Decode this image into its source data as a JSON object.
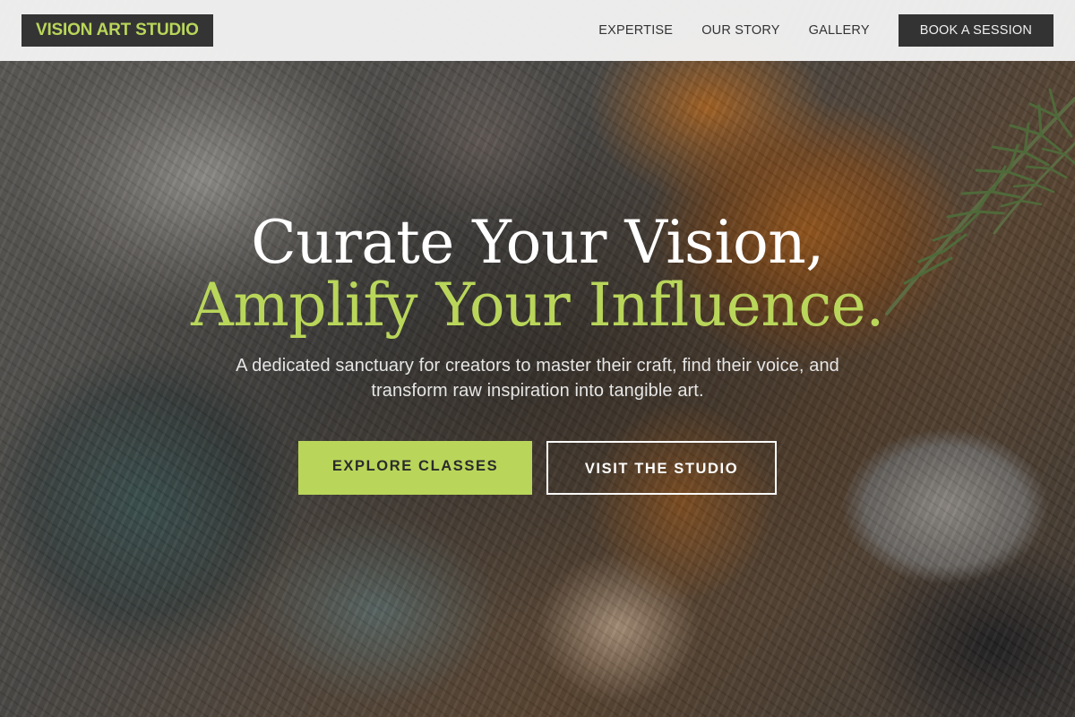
{
  "brand": {
    "logo_text": "VISION ART STUDIO",
    "accent_color": "#b9d65a",
    "dark_color": "#333333"
  },
  "nav": {
    "links": [
      {
        "label": "EXPERTISE"
      },
      {
        "label": "OUR STORY"
      },
      {
        "label": "GALLERY"
      }
    ],
    "cta_label": "BOOK A SESSION"
  },
  "hero": {
    "headline_line1": "Curate Your Vision,",
    "headline_line2": "Amplify Your Influence.",
    "subtitle": "A dedicated sanctuary for creators to master their craft, find their voice, and transform raw inspiration into tangible art.",
    "primary_button": "EXPLORE CLASSES",
    "secondary_button": "VISIT THE STUDIO",
    "background_image": "textured oil paint palette background"
  }
}
